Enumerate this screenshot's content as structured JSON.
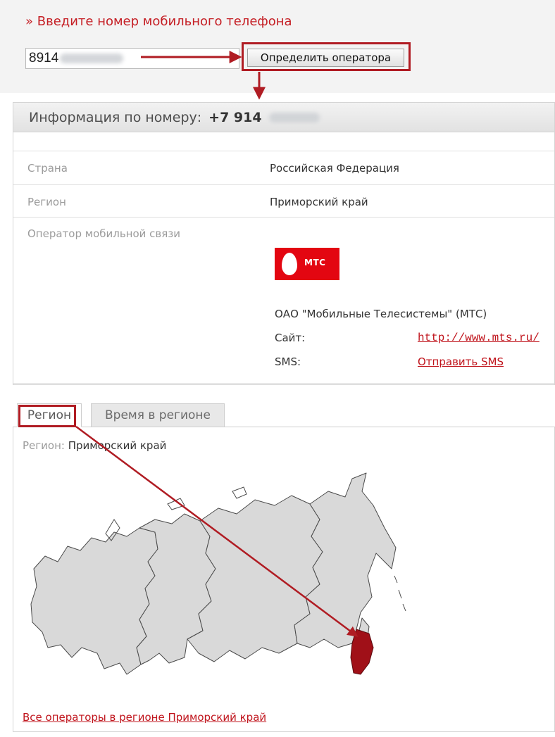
{
  "form": {
    "prompt": "» Введите номер мобильного телефона",
    "phone_value": "8914",
    "detect_button_label": "Определить оператора"
  },
  "info": {
    "header_label": "Информация по номеру:",
    "header_number": "+7 914",
    "rows": [
      {
        "label": "Страна",
        "value": "Российская Федерация"
      },
      {
        "label": "Регион",
        "value": "Приморский край"
      }
    ],
    "operator": {
      "label": "Оператор мобильной связи",
      "logo_text": "МТС",
      "name": "ОАО \"Мобильные Телесистемы\" (МТС)",
      "site_label": "Сайт:",
      "site_link": "http://www.mts.ru/",
      "sms_label": "SMS:",
      "sms_link": "Отправить SMS"
    }
  },
  "tabs": [
    "Регион",
    "Время в регионе"
  ],
  "region_panel": {
    "label": "Регион:",
    "value": "Приморский край",
    "all_operators_link": "Все операторы в регионе Приморский край"
  },
  "colors": {
    "accent_red": "#c51e24",
    "highlight_red": "#b01c23",
    "mts_red": "#e30611",
    "map_gray": "#d9d9d9",
    "map_selected": "#a01018"
  },
  "icons": [
    "mts-egg-icon",
    "arrow-icon"
  ]
}
